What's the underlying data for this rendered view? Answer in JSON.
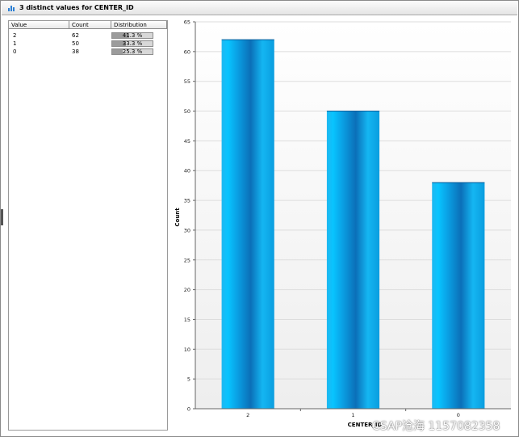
{
  "window": {
    "title": "3 distinct values for CENTER_ID"
  },
  "table": {
    "headers": [
      "Value",
      "Count",
      "Distribution"
    ],
    "rows": [
      {
        "value": "2",
        "count": "62",
        "dist_label": "41.3 %",
        "dist_fraction": 0.413
      },
      {
        "value": "1",
        "count": "50",
        "dist_label": "33.3 %",
        "dist_fraction": 0.333
      },
      {
        "value": "0",
        "count": "38",
        "dist_label": "25.3 %",
        "dist_fraction": 0.253
      }
    ]
  },
  "chart_data": {
    "type": "bar",
    "categories": [
      "2",
      "1",
      "0"
    ],
    "values": [
      62,
      50,
      38
    ],
    "xlabel": "CENTER_ID",
    "ylabel": "Count",
    "ylim": [
      0,
      65
    ],
    "yticks": [
      "0",
      "5",
      "10",
      "15",
      "20",
      "25",
      "30",
      "35",
      "40",
      "45",
      "50",
      "55",
      "60",
      "65"
    ],
    "grid": true,
    "bar_color": "#12a6e6"
  },
  "watermark": "CSAP沧海 1157082358"
}
